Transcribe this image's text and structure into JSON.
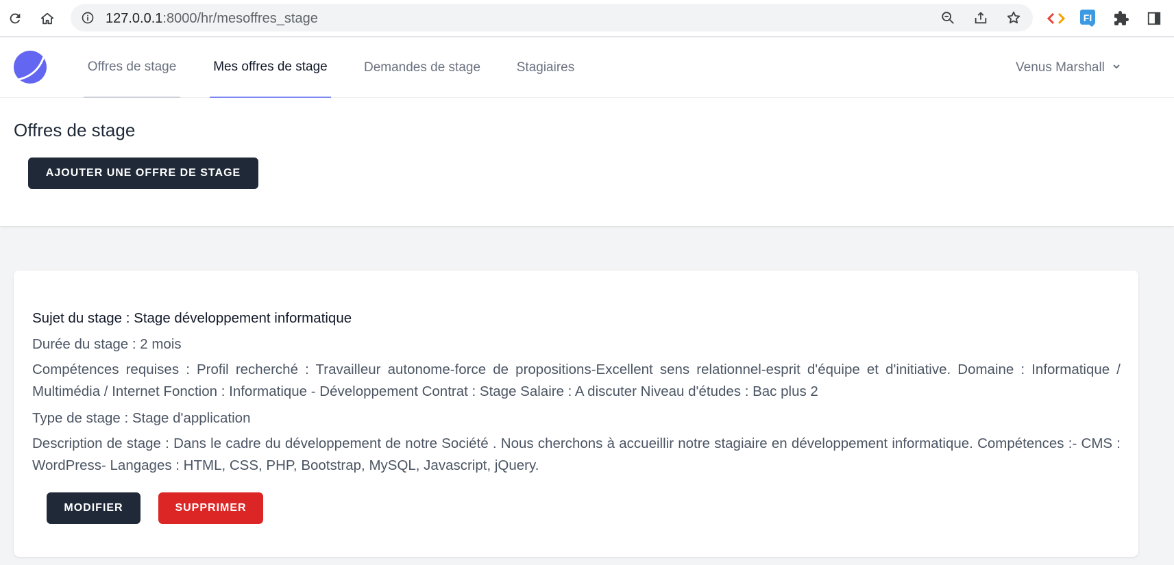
{
  "browser": {
    "url_host": "127.0.0.1",
    "url_path": ":8000/hr/mesoffres_stage",
    "icons": [
      "reload-icon",
      "home-icon",
      "site-info-icon",
      "zoom-out-icon",
      "share-icon",
      "bookmark-star-icon",
      "code-extension-icon",
      "fi-extension-icon",
      "extensions-puzzle-icon",
      "side-panel-icon"
    ],
    "fi_label": "FI"
  },
  "nav": {
    "links": [
      {
        "label": "Offres de stage"
      },
      {
        "label": "Mes offres de stage"
      },
      {
        "label": "Demandes de stage"
      },
      {
        "label": "Stagiaires"
      }
    ],
    "user_name": "Venus Marshall",
    "accent_color": "#818cf8"
  },
  "header": {
    "title": "Offres de stage",
    "add_button": "AJOUTER UNE OFFRE DE STAGE"
  },
  "offer": {
    "subject": "Sujet du stage : Stage développement informatique",
    "duration": "Durée du stage : 2 mois",
    "skills": "Compétences requises : Profil recherché : Travailleur autonome-force de propositions-Excellent sens relationnel-esprit d'équipe et d'initiative. Domaine : Informatique / Multimédia / Internet Fonction : Informatique - Développement Contrat : Stage Salaire : A discuter Niveau d'études : Bac plus 2",
    "type": "Type de stage : Stage d'application",
    "description": "Description de stage : Dans le cadre du développement de notre Société . Nous cherchons à accueillir notre stagiaire en développement informatique. Compétences :- CMS : WordPress- Langages : HTML, CSS, PHP, Bootstrap, MySQL, Javascript, jQuery.",
    "edit_button": "MODIFIER",
    "delete_button": "SUPPRIMER"
  },
  "colors": {
    "dark_button": "#1f2937",
    "delete_button": "#dc2626",
    "logo": "#6366f1"
  }
}
